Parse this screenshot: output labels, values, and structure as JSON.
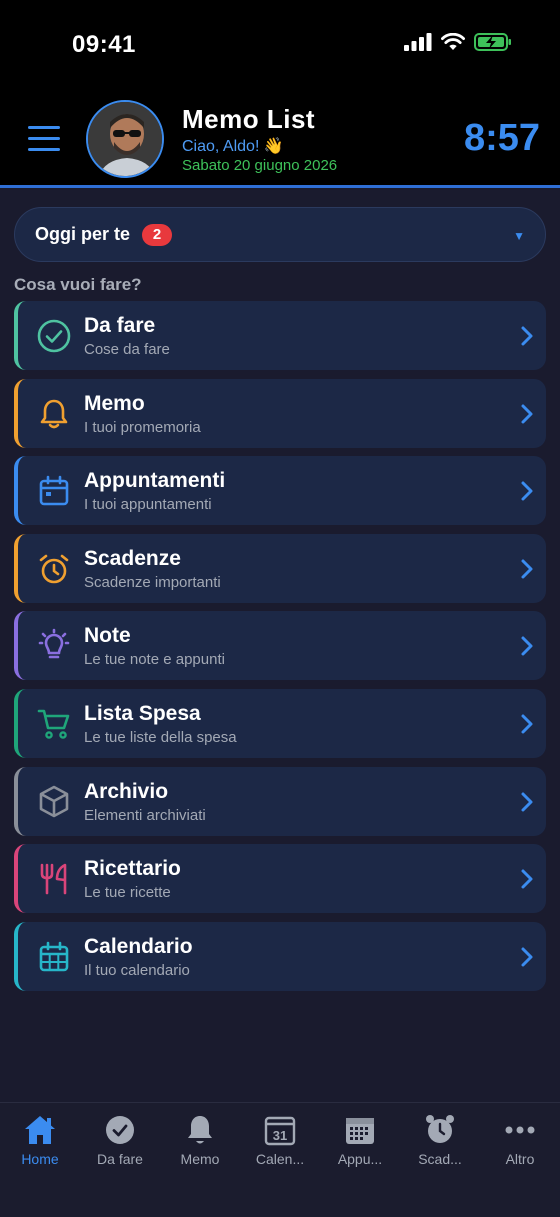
{
  "status_bar": {
    "time": "09:41"
  },
  "header": {
    "title": "Memo List",
    "greeting": "Ciao, Aldo! 👋",
    "date": "Sabato 20 giugno 2026",
    "clock": "8:57"
  },
  "today": {
    "label": "Oggi per te",
    "badge": "2"
  },
  "section_title": "Cosa vuoi fare?",
  "menu": [
    {
      "title": "Da fare",
      "subtitle": "Cose da fare",
      "icon": "check-circle-icon",
      "color": "#4fc3a1"
    },
    {
      "title": "Memo",
      "subtitle": "I tuoi promemoria",
      "icon": "bell-icon",
      "color": "#f0a030"
    },
    {
      "title": "Appuntamenti",
      "subtitle": "I tuoi appuntamenti",
      "icon": "calendar-icon",
      "color": "#3b8cf0"
    },
    {
      "title": "Scadenze",
      "subtitle": "Scadenze importanti",
      "icon": "alarm-icon",
      "color": "#f0a030"
    },
    {
      "title": "Note",
      "subtitle": "Le tue note e appunti",
      "icon": "lightbulb-icon",
      "color": "#8a6fe0"
    },
    {
      "title": "Lista Spesa",
      "subtitle": "Le tue liste della spesa",
      "icon": "cart-icon",
      "color": "#1fa67a"
    },
    {
      "title": "Archivio",
      "subtitle": "Elementi archiviati",
      "icon": "box-icon",
      "color": "#8a8f99"
    },
    {
      "title": "Ricettario",
      "subtitle": "Le tue ricette",
      "icon": "cutlery-icon",
      "color": "#d9457a"
    },
    {
      "title": "Calendario",
      "subtitle": "Il tuo calendario",
      "icon": "calendar-grid-icon",
      "color": "#27b6c9"
    }
  ],
  "tabs": [
    {
      "label": "Home",
      "icon": "home-icon",
      "active": true
    },
    {
      "label": "Da fare",
      "icon": "check-circle-icon"
    },
    {
      "label": "Memo",
      "icon": "bell-icon"
    },
    {
      "label": "Calen...",
      "icon": "calendar-31-icon",
      "icon_text": "31"
    },
    {
      "label": "Appu...",
      "icon": "calendar-grid-icon"
    },
    {
      "label": "Scad...",
      "icon": "alarm-clock-icon"
    },
    {
      "label": "Altro",
      "icon": "more-icon"
    }
  ],
  "colors": {
    "accent": "#3b8cf0",
    "date": "#3ec15a",
    "badge": "#e8393d",
    "card": "#1c2846",
    "background": "#1a1b2e"
  }
}
